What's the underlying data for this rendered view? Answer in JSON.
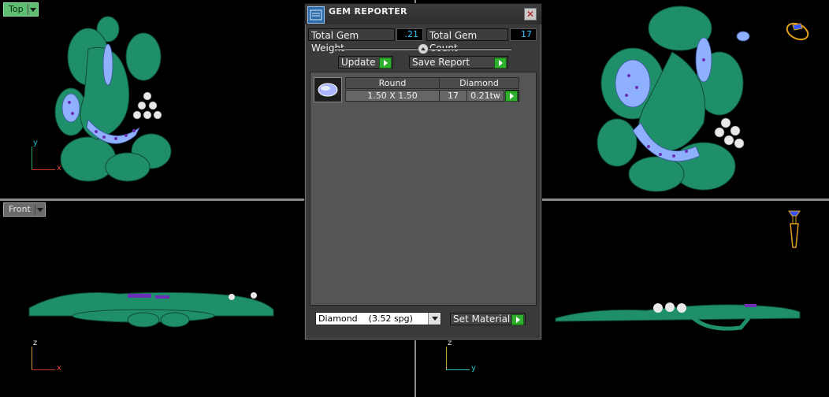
{
  "viewports": {
    "top": {
      "label": "Top",
      "axes": {
        "v": "y",
        "h": "x"
      }
    },
    "front": {
      "label": "Front",
      "axes": {
        "v": "z",
        "h": "x"
      }
    },
    "right": {
      "axes": {
        "v": "z",
        "h": "y"
      }
    }
  },
  "colors": {
    "model_green": "#1f8f6a",
    "gem_blue": "#8fb0ff",
    "gem_purple": "#6a2fb5",
    "axis_red": "#c0392b",
    "axis_green": "#27ae60",
    "axis_cyan": "#2ec4c4",
    "active_tab": "#5fbd73",
    "value_text": "#36c8ff",
    "gizmo_orange": "#e0a020"
  },
  "dialog": {
    "title": "GEM REPORTER",
    "close_icon": "close-x",
    "total_weight_label": "Total Gem Weight",
    "total_weight_value": ".21",
    "total_count_label": "Total Gem Count",
    "total_count_value": "17",
    "update_label": "Update",
    "save_report_label": "Save Report",
    "table": {
      "headers": [
        "Round",
        "Diamond"
      ],
      "rows": [
        {
          "size": "1.50 X 1.50",
          "count": "17",
          "weight": "0.21tw"
        }
      ]
    },
    "material_select": {
      "value": "Diamond",
      "spg": "(3.52 spg)"
    },
    "set_material_label": "Set Material"
  }
}
